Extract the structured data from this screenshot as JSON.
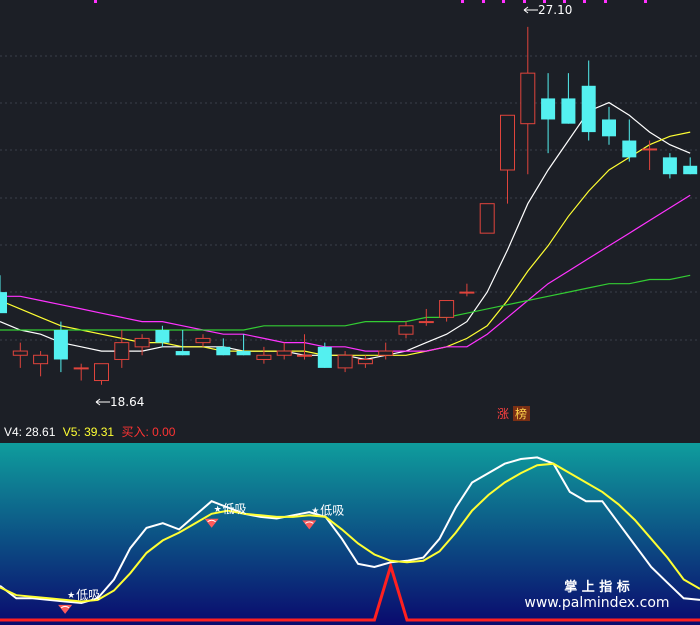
{
  "colors": {
    "background": "#1c1f26",
    "grid": "#3a3f4a",
    "up_candle": "#e0443c",
    "down_candle": "#54f0f0",
    "ma_white": "#ffffff",
    "ma_yellow": "#ffff33",
    "ma_magenta": "#ff33ff",
    "ma_green": "#33cc33",
    "indicator_top": "#0f9d9d",
    "indicator_bottom": "#0a0a6e",
    "signal_line": "#ff2020",
    "v4_color": "#ffffff",
    "v5_color": "#ffff33",
    "buy_color": "#ff3333"
  },
  "legend": {
    "v4_text": "V4: 28.61",
    "v5_text": "V5: 39.31",
    "buy_text": "买入: 0.00"
  },
  "price_annotations": {
    "high_label": "27.10",
    "low_label": "18.64"
  },
  "badge": {
    "char1": "涨",
    "char2": "榜"
  },
  "signal_label": "低吸",
  "watermark": {
    "line1": "掌 上 指 标",
    "line2": "www.palmindex.com"
  },
  "chart_data": [
    {
      "type": "candlestick",
      "price_range": [
        18.0,
        27.5
      ],
      "candles": [
        {
          "o": 20.8,
          "h": 21.2,
          "l": 20.4,
          "c": 20.3
        },
        {
          "o": 19.3,
          "h": 19.6,
          "l": 19.0,
          "c": 19.4
        },
        {
          "o": 19.1,
          "h": 19.4,
          "l": 18.8,
          "c": 19.3
        },
        {
          "o": 19.9,
          "h": 20.1,
          "l": 18.9,
          "c": 19.2
        },
        {
          "o": 19.0,
          "h": 19.1,
          "l": 18.7,
          "c": 19.0
        },
        {
          "o": 18.7,
          "h": 19.1,
          "l": 18.6,
          "c": 19.1
        },
        {
          "o": 19.2,
          "h": 19.9,
          "l": 19.0,
          "c": 19.6
        },
        {
          "o": 19.5,
          "h": 19.8,
          "l": 19.3,
          "c": 19.7
        },
        {
          "o": 19.9,
          "h": 20.0,
          "l": 19.5,
          "c": 19.6
        },
        {
          "o": 19.4,
          "h": 19.9,
          "l": 19.3,
          "c": 19.3
        },
        {
          "o": 19.6,
          "h": 19.8,
          "l": 19.5,
          "c": 19.7
        },
        {
          "o": 19.5,
          "h": 19.7,
          "l": 19.3,
          "c": 19.3
        },
        {
          "o": 19.4,
          "h": 19.8,
          "l": 19.3,
          "c": 19.3
        },
        {
          "o": 19.2,
          "h": 19.5,
          "l": 19.1,
          "c": 19.3
        },
        {
          "o": 19.3,
          "h": 19.6,
          "l": 19.2,
          "c": 19.4
        },
        {
          "o": 19.3,
          "h": 19.8,
          "l": 19.2,
          "c": 19.3
        },
        {
          "o": 19.5,
          "h": 19.6,
          "l": 19.0,
          "c": 19.0
        },
        {
          "o": 19.0,
          "h": 19.4,
          "l": 18.9,
          "c": 19.3
        },
        {
          "o": 19.1,
          "h": 19.3,
          "l": 19.0,
          "c": 19.2
        },
        {
          "o": 19.3,
          "h": 19.6,
          "l": 19.2,
          "c": 19.4
        },
        {
          "o": 19.8,
          "h": 20.1,
          "l": 19.7,
          "c": 20.0
        },
        {
          "o": 20.1,
          "h": 20.4,
          "l": 20.0,
          "c": 20.1
        },
        {
          "o": 20.2,
          "h": 20.6,
          "l": 20.1,
          "c": 20.6
        },
        {
          "o": 20.8,
          "h": 21.0,
          "l": 20.7,
          "c": 20.8
        },
        {
          "o": 22.2,
          "h": 22.4,
          "l": 22.2,
          "c": 22.9
        },
        {
          "o": 23.7,
          "h": 24.5,
          "l": 22.9,
          "c": 25.0
        },
        {
          "o": 24.8,
          "h": 27.1,
          "l": 23.6,
          "c": 26.0
        },
        {
          "o": 25.4,
          "h": 26.0,
          "l": 24.1,
          "c": 24.9
        },
        {
          "o": 25.4,
          "h": 26.0,
          "l": 24.8,
          "c": 24.8
        },
        {
          "o": 25.7,
          "h": 26.3,
          "l": 24.4,
          "c": 24.6
        },
        {
          "o": 24.9,
          "h": 25.2,
          "l": 24.3,
          "c": 24.5
        },
        {
          "o": 24.4,
          "h": 24.9,
          "l": 23.9,
          "c": 24.0
        },
        {
          "o": 24.2,
          "h": 24.4,
          "l": 23.7,
          "c": 24.2
        },
        {
          "o": 24.0,
          "h": 24.1,
          "l": 23.5,
          "c": 23.6
        },
        {
          "o": 23.8,
          "h": 24.0,
          "l": 23.6,
          "c": 23.6
        }
      ],
      "ma": [
        {
          "name": "ma-white",
          "color": "#ffffff",
          "values": [
            20.1,
            19.9,
            19.8,
            19.6,
            19.5,
            19.4,
            19.4,
            19.4,
            19.5,
            19.5,
            19.5,
            19.5,
            19.4,
            19.4,
            19.4,
            19.3,
            19.3,
            19.3,
            19.2,
            19.3,
            19.4,
            19.6,
            19.8,
            20.1,
            20.8,
            21.8,
            22.9,
            23.7,
            24.4,
            25.1,
            25.3,
            25.0,
            24.6,
            24.3,
            24.1
          ]
        },
        {
          "name": "ma-yellow",
          "color": "#ffff33",
          "values": [
            20.6,
            20.4,
            20.2,
            20.0,
            19.9,
            19.8,
            19.7,
            19.6,
            19.6,
            19.5,
            19.5,
            19.4,
            19.4,
            19.4,
            19.4,
            19.4,
            19.3,
            19.3,
            19.3,
            19.3,
            19.3,
            19.4,
            19.5,
            19.7,
            20.0,
            20.6,
            21.3,
            21.9,
            22.6,
            23.2,
            23.7,
            24.0,
            24.3,
            24.5,
            24.6
          ]
        },
        {
          "name": "ma-magenta",
          "color": "#ff33ff",
          "values": [
            20.7,
            20.7,
            20.6,
            20.5,
            20.4,
            20.3,
            20.2,
            20.1,
            20.1,
            20.0,
            19.9,
            19.8,
            19.8,
            19.7,
            19.6,
            19.6,
            19.5,
            19.5,
            19.4,
            19.4,
            19.4,
            19.4,
            19.5,
            19.5,
            19.8,
            20.2,
            20.6,
            21.0,
            21.3,
            21.6,
            21.9,
            22.2,
            22.5,
            22.8,
            23.1
          ]
        },
        {
          "name": "ma-green",
          "color": "#33cc33",
          "values": [
            19.9,
            19.9,
            19.9,
            19.9,
            19.9,
            19.9,
            19.9,
            19.9,
            19.9,
            19.9,
            19.9,
            19.9,
            19.9,
            20.0,
            20.0,
            20.0,
            20.0,
            20.0,
            20.1,
            20.1,
            20.1,
            20.2,
            20.2,
            20.3,
            20.4,
            20.5,
            20.6,
            20.7,
            20.8,
            20.9,
            21.0,
            21.0,
            21.1,
            21.1,
            21.2
          ]
        }
      ]
    },
    {
      "type": "line",
      "range": [
        0,
        100
      ],
      "series": [
        {
          "name": "V4",
          "color": "#ffffff",
          "values": [
            18,
            10,
            10,
            9,
            8,
            7,
            10,
            22,
            42,
            55,
            58,
            54,
            63,
            72,
            68,
            64,
            62,
            61,
            63,
            65,
            62,
            48,
            32,
            30,
            33,
            34,
            36,
            48,
            68,
            84,
            90,
            96,
            99,
            100,
            96,
            78,
            72,
            72,
            58,
            44,
            30,
            20,
            10,
            9
          ]
        },
        {
          "name": "V5",
          "color": "#ffff33",
          "values": [
            17,
            12,
            11,
            10,
            9,
            8,
            9,
            15,
            26,
            39,
            47,
            52,
            58,
            64,
            66,
            64,
            63,
            62,
            62,
            63,
            62,
            54,
            45,
            38,
            34,
            33,
            34,
            40,
            52,
            66,
            76,
            84,
            90,
            95,
            96,
            90,
            84,
            78,
            70,
            60,
            48,
            36,
            22,
            16
          ]
        }
      ],
      "signals": [
        {
          "index": 4,
          "label": "低吸"
        },
        {
          "index": 13,
          "label": "低吸"
        },
        {
          "index": 19,
          "label": "低吸"
        }
      ],
      "buy_signal": {
        "values": [
          0,
          0,
          0,
          0,
          0,
          0,
          0,
          0,
          0,
          0,
          0,
          0,
          0,
          0,
          0,
          0,
          0,
          0,
          0,
          0,
          0,
          0,
          0,
          0,
          1,
          0,
          0,
          0,
          0,
          0,
          0,
          0,
          0,
          0,
          0,
          0,
          0,
          0,
          0,
          0,
          0,
          0,
          0,
          0
        ]
      }
    }
  ]
}
